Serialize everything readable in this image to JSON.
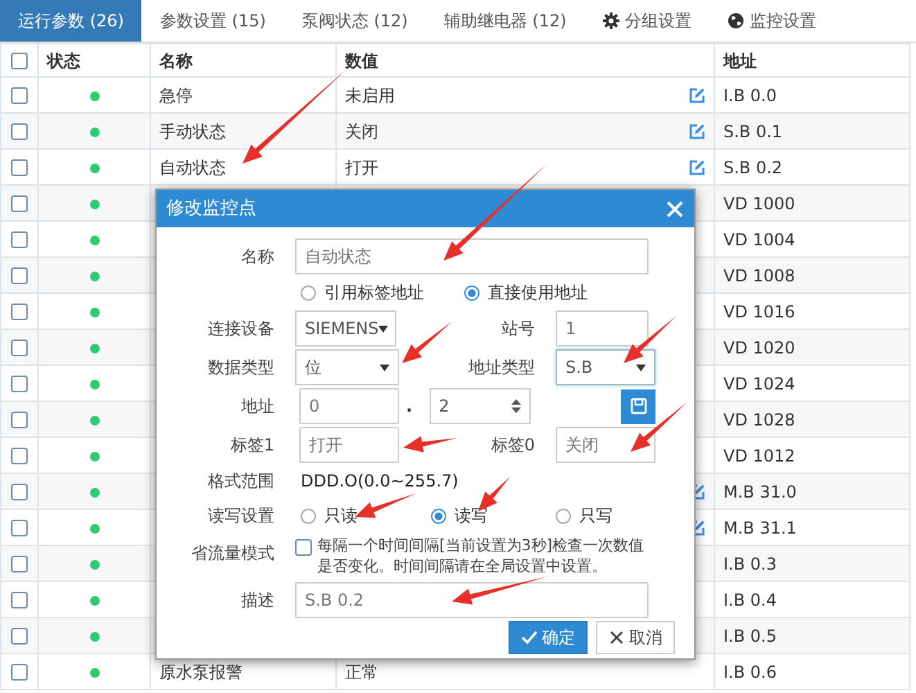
{
  "tabs": [
    {
      "label": "运行参数 (26)",
      "selected": true
    },
    {
      "label": "参数设置 (15)",
      "selected": false
    },
    {
      "label": "泵阀状态 (12)",
      "selected": false
    },
    {
      "label": "辅助继电器 (12)",
      "selected": false
    },
    {
      "label": "分组设置",
      "kind": "gear",
      "selected": false
    },
    {
      "label": "监控设置",
      "kind": "globe",
      "selected": false
    }
  ],
  "table": {
    "select_all": {
      "checked": false
    },
    "columns": [
      "状态",
      "名称",
      "数值",
      "地址"
    ],
    "rows": [
      {
        "checked": false,
        "name": "急停",
        "value": "未启用",
        "editable": true,
        "address": "I.B 0.0"
      },
      {
        "checked": false,
        "name": "手动状态",
        "value": "关闭",
        "editable": true,
        "address": "S.B 0.1"
      },
      {
        "checked": false,
        "name": "自动状态",
        "value": "打开",
        "editable": true,
        "address": "S.B 0.2"
      },
      {
        "checked": false,
        "editable": false,
        "address": "VD 1000"
      },
      {
        "checked": false,
        "editable": false,
        "address": "VD 1004"
      },
      {
        "checked": false,
        "editable": false,
        "address": "VD 1008"
      },
      {
        "checked": false,
        "editable": false,
        "address": "VD 1016"
      },
      {
        "checked": false,
        "editable": false,
        "address": "VD 1020"
      },
      {
        "checked": false,
        "editable": false,
        "address": "VD 1024"
      },
      {
        "checked": false,
        "editable": false,
        "address": "VD 1028"
      },
      {
        "checked": false,
        "editable": false,
        "address": "VD 1012"
      },
      {
        "checked": false,
        "editable": true,
        "address": "M.B 31.0"
      },
      {
        "checked": false,
        "editable": true,
        "address": "M.B 31.1"
      },
      {
        "checked": false,
        "editable": false,
        "address": "I.B 0.3"
      },
      {
        "checked": false,
        "editable": false,
        "address": "I.B 0.4"
      },
      {
        "checked": false,
        "editable": false,
        "address": "I.B 0.5"
      },
      {
        "checked": false,
        "name": "原水泵报警",
        "value": "正常",
        "editable": false,
        "address": "I.B 0.6"
      }
    ]
  },
  "dialog": {
    "title": "修改监控点",
    "name": {
      "label": "名称",
      "value": "自动状态"
    },
    "source_options": [
      {
        "label": "引用标签地址",
        "selected": false
      },
      {
        "label": "直接使用地址",
        "selected": true
      }
    ],
    "device": {
      "label": "连接设备",
      "value": "SIEMENS"
    },
    "station": {
      "label": "站号",
      "value": "1"
    },
    "data_type": {
      "label": "数据类型",
      "value": "位"
    },
    "address_type": {
      "label": "地址类型",
      "value": "S.B"
    },
    "address": {
      "label": "地址",
      "value": "0",
      "separator": ".",
      "bit": "2"
    },
    "label1": {
      "label": "标签1",
      "value": "打开"
    },
    "label0": {
      "label": "标签0",
      "value": "关闭"
    },
    "format": {
      "label": "格式范围",
      "value": "DDD.O(0.0~255.7)"
    },
    "read_write": {
      "label": "读写设置",
      "options": [
        {
          "label": "只读",
          "selected": false
        },
        {
          "label": "读写",
          "selected": true
        },
        {
          "label": "只写",
          "selected": false
        }
      ]
    },
    "saving_mode": {
      "label": "省流量模式",
      "checked": false,
      "text": "每隔一个时间间隔[当前设置为3秒]检查一次数值是否变化。时间间隔请在全局设置中设置。"
    },
    "description": {
      "label": "描述",
      "value": "S.B 0.2"
    },
    "buttons": [
      {
        "label": "确定",
        "kind": "primary"
      },
      {
        "label": "取消",
        "kind": "secondary"
      }
    ]
  }
}
